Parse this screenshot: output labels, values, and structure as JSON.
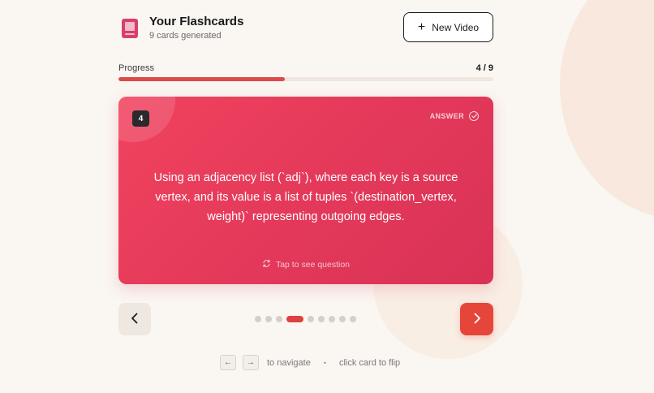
{
  "header": {
    "title": "Your Flashcards",
    "subtitle": "9 cards generated",
    "new_video_label": "New Video",
    "new_video_icon": "plus-icon"
  },
  "progress": {
    "label": "Progress",
    "count_text": "4 / 9",
    "fraction": 0.444,
    "fill_color": "#dd4a4a"
  },
  "card": {
    "number": "4",
    "side_label": "ANSWER",
    "text": "Using an adjacency list (`adj`), where each key is a source vertex, and its value is a list of tuples `(destination_vertex, weight)` representing outgoing edges.",
    "flip_hint": "Tap to see question",
    "gradient": [
      "#f0435e",
      "#d83256"
    ]
  },
  "navigation": {
    "total": 9,
    "current_index": 3,
    "prev_icon": "chevron-left-icon",
    "next_icon": "chevron-right-icon",
    "next_color": "#e6463a"
  },
  "footer": {
    "left_key": "←",
    "right_key": "→",
    "navigate_text": "to navigate",
    "separator": "•",
    "flip_text": "click card to flip"
  }
}
